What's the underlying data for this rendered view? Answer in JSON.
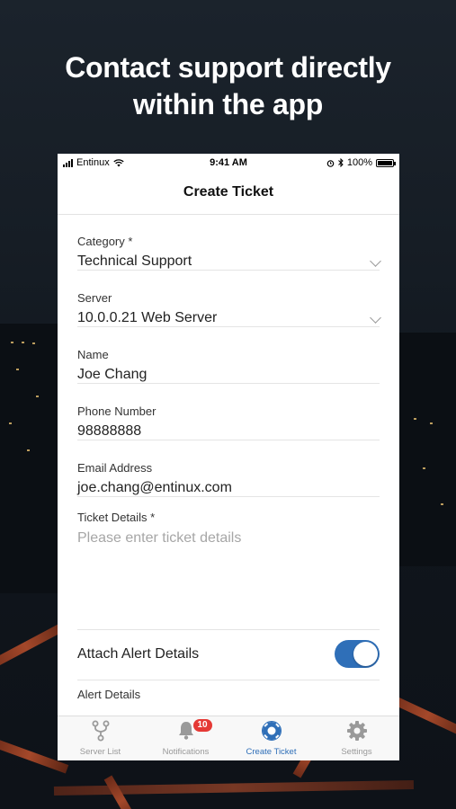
{
  "headline": {
    "line1": "Contact support directly",
    "line2": "within the app"
  },
  "status_bar": {
    "carrier": "Entinux",
    "time": "9:41 AM",
    "battery": "100%",
    "icons": [
      "signal-bars-icon",
      "wifi-icon",
      "alarm-icon",
      "bluetooth-icon",
      "battery-icon"
    ]
  },
  "nav": {
    "title": "Create Ticket"
  },
  "form": {
    "category": {
      "label": "Category *",
      "value": "Technical Support"
    },
    "server": {
      "label": "Server",
      "value": "10.0.0.21 Web Server"
    },
    "name": {
      "label": "Name",
      "value": "Joe Chang"
    },
    "phone": {
      "label": "Phone Number",
      "value": "98888888"
    },
    "email": {
      "label": "Email Address",
      "value": "joe.chang@entinux.com"
    },
    "details": {
      "label": "Ticket Details *",
      "placeholder": "Please enter ticket details"
    },
    "attach": {
      "label": "Attach Alert Details",
      "enabled": true
    },
    "alert_details": {
      "label": "Alert Details"
    }
  },
  "tabs": [
    {
      "label": "Server List",
      "icon": "branch-icon",
      "active": false
    },
    {
      "label": "Notifications",
      "icon": "bell-icon",
      "badge": "10",
      "active": false
    },
    {
      "label": "Create Ticket",
      "icon": "lifebuoy-icon",
      "active": true
    },
    {
      "label": "Settings",
      "icon": "gear-icon",
      "active": false
    }
  ],
  "colors": {
    "accent": "#2f6fb8",
    "badge": "#e53935",
    "background": "#141a22"
  }
}
